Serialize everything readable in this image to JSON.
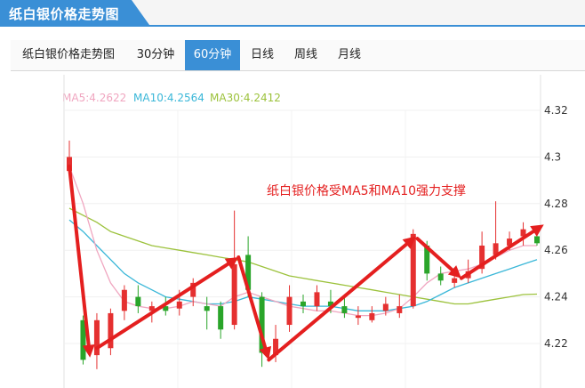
{
  "header": {
    "title": "纸白银价格走势图"
  },
  "tabs": [
    {
      "label": "纸白银价格走势图",
      "active": false
    },
    {
      "label": "30分钟",
      "active": false
    },
    {
      "label": "60分钟",
      "active": true
    },
    {
      "label": "日线",
      "active": false
    },
    {
      "label": "周线",
      "active": false
    },
    {
      "label": "月线",
      "active": false
    }
  ],
  "colors": {
    "accent": "#3a8fd6",
    "up": "#e53030",
    "down": "#2aa52a",
    "ma5": "#f0a6c0",
    "ma10": "#3ab7d8",
    "ma30": "#9cc23c",
    "arrow": "#e41f1f"
  },
  "legend": [
    {
      "label": "MA5:4.2622",
      "color": "#f0a6c0"
    },
    {
      "label": "MA10:4.2564",
      "color": "#3ab7d8"
    },
    {
      "label": "MA30:4.2412",
      "color": "#9cc23c"
    }
  ],
  "chart_data": {
    "type": "candlestick",
    "title": "",
    "annotation": "纸白银价格受MA5和MA10强力支撑",
    "y_ticks": [
      "4.32",
      "4.3",
      "4.28",
      "4.26",
      "4.24",
      "4.22"
    ],
    "ylim": [
      4.21,
      4.32
    ],
    "grid": true,
    "candles": [
      {
        "o": 4.294,
        "c": 4.3,
        "h": 4.307,
        "l": 4.293
      },
      {
        "o": 4.23,
        "c": 4.213,
        "h": 4.232,
        "l": 4.211
      },
      {
        "o": 4.215,
        "c": 4.23,
        "h": 4.233,
        "l": 4.209
      },
      {
        "o": 4.218,
        "c": 4.233,
        "h": 4.235,
        "l": 4.215
      },
      {
        "o": 4.234,
        "c": 4.243,
        "h": 4.245,
        "l": 4.23
      },
      {
        "o": 4.24,
        "c": 4.236,
        "h": 4.245,
        "l": 4.233
      },
      {
        "o": 4.234,
        "c": 4.236,
        "h": 4.238,
        "l": 4.229
      },
      {
        "o": 4.236,
        "c": 4.234,
        "h": 4.24,
        "l": 4.232
      },
      {
        "o": 4.235,
        "c": 4.238,
        "h": 4.243,
        "l": 4.232
      },
      {
        "o": 4.24,
        "c": 4.246,
        "h": 4.248,
        "l": 4.236
      },
      {
        "o": 4.236,
        "c": 4.234,
        "h": 4.24,
        "l": 4.226
      },
      {
        "o": 4.236,
        "c": 4.226,
        "h": 4.238,
        "l": 4.222
      },
      {
        "o": 4.228,
        "c": 4.254,
        "h": 4.277,
        "l": 4.226
      },
      {
        "o": 4.258,
        "c": 4.243,
        "h": 4.266,
        "l": 4.24
      },
      {
        "o": 4.24,
        "c": 4.216,
        "h": 4.242,
        "l": 4.21
      },
      {
        "o": 4.215,
        "c": 4.222,
        "h": 4.228,
        "l": 4.212
      },
      {
        "o": 4.228,
        "c": 4.24,
        "h": 4.245,
        "l": 4.225
      },
      {
        "o": 4.238,
        "c": 4.236,
        "h": 4.241,
        "l": 4.233
      },
      {
        "o": 4.236,
        "c": 4.242,
        "h": 4.245,
        "l": 4.234
      },
      {
        "o": 4.238,
        "c": 4.236,
        "h": 4.243,
        "l": 4.233
      },
      {
        "o": 4.236,
        "c": 4.233,
        "h": 4.24,
        "l": 4.231
      },
      {
        "o": 4.231,
        "c": 4.232,
        "h": 4.236,
        "l": 4.228
      },
      {
        "o": 4.23,
        "c": 4.233,
        "h": 4.236,
        "l": 4.229
      },
      {
        "o": 4.234,
        "c": 4.237,
        "h": 4.24,
        "l": 4.232
      },
      {
        "o": 4.233,
        "c": 4.236,
        "h": 4.241,
        "l": 4.231
      },
      {
        "o": 4.236,
        "c": 4.267,
        "h": 4.269,
        "l": 4.235
      },
      {
        "o": 4.262,
        "c": 4.25,
        "h": 4.264,
        "l": 4.247
      },
      {
        "o": 4.25,
        "c": 4.247,
        "h": 4.253,
        "l": 4.245
      },
      {
        "o": 4.246,
        "c": 4.248,
        "h": 4.251,
        "l": 4.244
      },
      {
        "o": 4.248,
        "c": 4.251,
        "h": 4.256,
        "l": 4.246
      },
      {
        "o": 4.252,
        "c": 4.262,
        "h": 4.268,
        "l": 4.25
      },
      {
        "o": 4.258,
        "c": 4.263,
        "h": 4.281,
        "l": 4.256
      },
      {
        "o": 4.262,
        "c": 4.265,
        "h": 4.268,
        "l": 4.26
      },
      {
        "o": 4.266,
        "c": 4.269,
        "h": 4.272,
        "l": 4.262
      },
      {
        "o": 4.266,
        "c": 4.263,
        "h": 4.27,
        "l": 4.262
      }
    ],
    "ma5": [
      4.296,
      4.28,
      4.26,
      4.246,
      4.238,
      4.236,
      4.235,
      4.235,
      4.236,
      4.238,
      4.237,
      4.236,
      4.24,
      4.242,
      4.24,
      4.238,
      4.236,
      4.235,
      4.234,
      4.234,
      4.233,
      4.232,
      4.232,
      4.233,
      4.235,
      4.24,
      4.246,
      4.25,
      4.251,
      4.252,
      4.254,
      4.257,
      4.26,
      4.262,
      4.262
    ],
    "ma10": [
      4.273,
      4.268,
      4.262,
      4.256,
      4.25,
      4.246,
      4.243,
      4.24,
      4.239,
      4.238,
      4.237,
      4.237,
      4.238,
      4.24,
      4.239,
      4.238,
      4.237,
      4.236,
      4.236,
      4.236,
      4.235,
      4.234,
      4.234,
      4.234,
      4.235,
      4.236,
      4.238,
      4.241,
      4.244,
      4.246,
      4.248,
      4.25,
      4.252,
      4.254,
      4.256
    ],
    "ma30": [
      4.278,
      4.275,
      4.272,
      4.268,
      4.266,
      4.264,
      4.262,
      4.261,
      4.26,
      4.259,
      4.258,
      4.257,
      4.256,
      4.255,
      4.253,
      4.251,
      4.249,
      4.248,
      4.247,
      4.246,
      4.245,
      4.244,
      4.243,
      4.242,
      4.241,
      4.24,
      4.239,
      4.238,
      4.237,
      4.237,
      4.238,
      4.239,
      4.24,
      4.241,
      4.2412
    ],
    "arrows": [
      {
        "from": 0,
        "from_y": 4.296,
        "to": 1.5,
        "to_y": 4.214
      },
      {
        "from": 2,
        "from_y": 4.218,
        "to": 12.3,
        "to_y": 4.257
      },
      {
        "from": 12.3,
        "from_y": 4.257,
        "to": 14.5,
        "to_y": 4.213
      },
      {
        "from": 14.5,
        "from_y": 4.213,
        "to": 25.2,
        "to_y": 4.266
      },
      {
        "from": 25.3,
        "from_y": 4.265,
        "to": 28.5,
        "to_y": 4.248
      },
      {
        "from": 28.5,
        "from_y": 4.248,
        "to": 34.5,
        "to_y": 4.271
      }
    ]
  }
}
